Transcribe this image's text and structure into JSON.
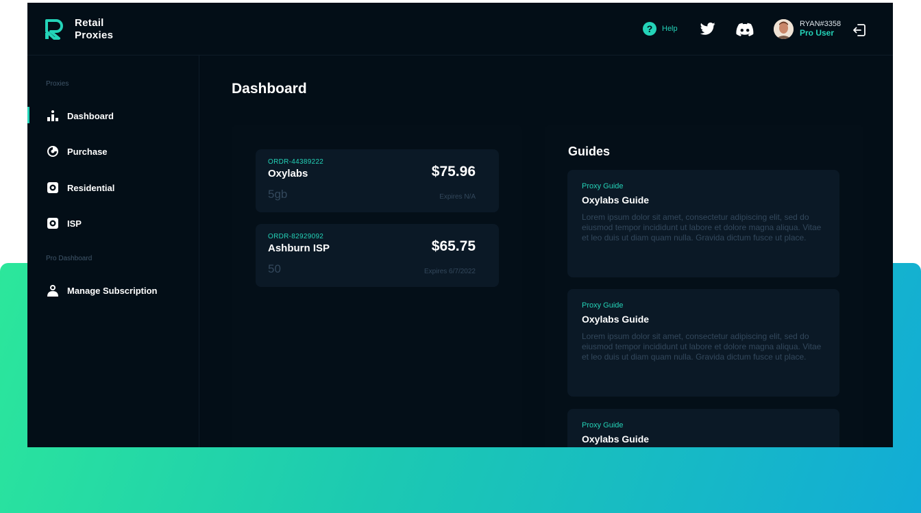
{
  "brand": {
    "line1": "Retail",
    "line2": "Proxies"
  },
  "header": {
    "help_label": "Help",
    "username": "RYAN#3358",
    "role": "Pro User"
  },
  "sidebar": {
    "section_proxies": "Proxies",
    "items": [
      {
        "label": "Dashboard",
        "icon": "dashboard-icon",
        "active": true
      },
      {
        "label": "Purchase",
        "icon": "purchase-icon"
      },
      {
        "label": "Residential",
        "icon": "residential-icon"
      },
      {
        "label": "ISP",
        "icon": "isp-icon"
      }
    ],
    "section_pro": "Pro Dashboard",
    "pro_items": [
      {
        "label": "Manage Subscription",
        "icon": "user-icon"
      }
    ]
  },
  "main": {
    "title": "Dashboard",
    "orders": [
      {
        "id": "ORDR-44389222",
        "name": "Oxylabs",
        "quantity": "5gb",
        "price": "$75.96",
        "expires": "Expires N/A"
      },
      {
        "id": "ORDR-82929092",
        "name": "Ashburn ISP",
        "quantity": "50",
        "price": "$65.75",
        "expires": "Expires 6/7/2022"
      }
    ],
    "guides_title": "Guides",
    "guides": [
      {
        "category": "Proxy Guide",
        "title": "Oxylabs Guide",
        "text": "Lorem ipsum dolor sit amet, consectetur adipiscing elit, sed do eiusmod tempor incididunt ut labore et dolore magna aliqua. Vitae et leo duis ut diam quam nulla. Gravida dictum fusce ut place."
      },
      {
        "category": "Proxy Guide",
        "title": "Oxylabs Guide",
        "text": "Lorem ipsum dolor sit amet, consectetur adipiscing elit, sed do eiusmod tempor incididunt ut labore et dolore magna aliqua. Vitae et leo duis ut diam quam nulla. Gravida dictum fusce ut place."
      },
      {
        "category": "Proxy Guide",
        "title": "Oxylabs Guide",
        "text": ""
      }
    ]
  },
  "colors": {
    "accent": "#24d3b8",
    "background": "#030e17",
    "card": "#0b1926"
  }
}
